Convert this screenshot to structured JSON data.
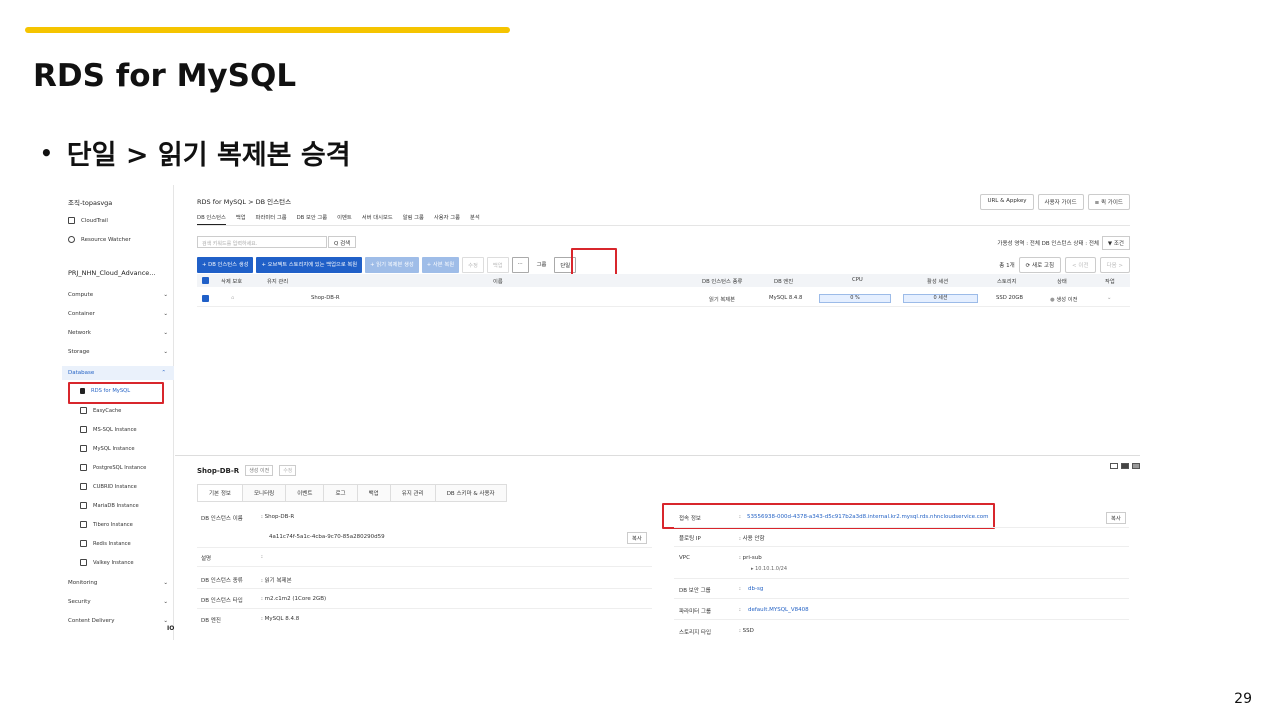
{
  "slide": {
    "title": "RDS for MySQL",
    "bullet": "단일 > 읽기 복제본 승격",
    "page_number": "29"
  },
  "sidebar": {
    "org": "조직-topasvga",
    "org_items": [
      {
        "label": "CloudTrail",
        "icon": "cloudtrail-icon"
      },
      {
        "label": "Resource Watcher",
        "icon": "gear-icon"
      }
    ],
    "project": "PRJ_NHN_Cloud_Advance...",
    "categories_top": [
      "Compute",
      "Container",
      "Network",
      "Storage"
    ],
    "active_category": "Database",
    "services": [
      "RDS for MySQL",
      "EasyCache",
      "MS-SQL Instance",
      "MySQL Instance",
      "PostgreSQL Instance",
      "CUBRID Instance",
      "MariaDB Instance",
      "Tibero Instance",
      "Redis Instance",
      "Valkey Instance"
    ],
    "selected_service": "RDS for MySQL",
    "categories_bottom": [
      "Monitoring",
      "Security",
      "Content Delivery"
    ],
    "footer_badge": "IO"
  },
  "console": {
    "breadcrumb": "RDS for MySQL  >  DB 인스턴스",
    "top_buttons": [
      "URL & Appkey",
      "사용자 가이드",
      "≡ 퀵 가이드"
    ],
    "tabs": [
      "DB 인스턴스",
      "백업",
      "파라미터 그룹",
      "DB 보안 그룹",
      "이벤트",
      "서버 대시보드",
      "알림 그룹",
      "사용자 그룹",
      "분석"
    ],
    "search_placeholder": "검색 키워드를 입력하세요.",
    "search_button": "Q 검색",
    "filter_text": "가용성 영역 : 전체   DB 인스턴스 상태 : 전체",
    "filter_button": "▼ 조건",
    "actions": {
      "create": "+ DB 인스턴스 생성",
      "restore": "+ 오브젝트 스토리지에 있는 백업으로 복원",
      "replica": "+ 읽기 복제본 생성",
      "copy": "+ 사본 복원",
      "modify": "수정",
      "backup": "백업",
      "more": "···",
      "group": "그룹",
      "single": "단일"
    },
    "count": "총 1개",
    "refresh": "새로 고침",
    "prev": "< 이전",
    "next": "다음 >",
    "table_headers": [
      "삭제 보호",
      "유지 관리",
      "이름",
      "DB 인스턴스 종류",
      "DB 엔진",
      "CPU",
      "활성 세션",
      "스토리지",
      "상태",
      "작업"
    ],
    "row": {
      "name": "Shop-DB-R",
      "type": "읽기 복제본",
      "engine": "MySQL 8.4.8",
      "cpu": "0 %",
      "cpu_fraction": 0.0,
      "sessions": "0 세션",
      "storage": "SSD 20GB",
      "status": "생성 이전"
    }
  },
  "detail": {
    "title": "Shop-DB-R",
    "badge_status": "생성 이전",
    "badge_edit": "수정",
    "tabs": [
      "기본 정보",
      "모니터링",
      "이벤트",
      "로그",
      "백업",
      "유지 관리",
      "DB 스키마 & 사용자"
    ],
    "left": [
      {
        "key": "DB 인스턴스 이름",
        "value": "Shop-DB-R"
      },
      {
        "key": "",
        "value": "4a11c74f-5a1c-4cba-9c70-85a280290d59"
      },
      {
        "key": "설명",
        "value": ""
      },
      {
        "key": "DB 인스턴스 종류",
        "value": "읽기 복제본"
      },
      {
        "key": "DB 인스턴스 타입",
        "value": "m2.c1m2 (1Core 2GB)"
      },
      {
        "key": "DB 엔진",
        "value": "MySQL 8.4.8"
      }
    ],
    "right": {
      "endpoint_label": "접속 정보",
      "endpoint": "53556938-000d-4378-a343-d5c917b2a3d8.internal.kr2.mysql.rds.nhncloudservice.com",
      "floating_ip_label": "플로팅 IP",
      "floating_ip": "사용 안함",
      "vpc_label": "VPC",
      "vpc": "pri-sub",
      "vpc_cidr": "10.10.1.0/24",
      "secgroup_label": "DB 보안 그룹",
      "secgroup": "db-sg",
      "param_label": "파라미터 그룹",
      "param": "default.MYSQL_V8408",
      "storage_label": "스토리지 타입",
      "storage": "SSD"
    },
    "copy_label": "복사"
  },
  "colors": {
    "accent_yellow": "#f5c400",
    "highlight_red": "#d8262c",
    "primary_blue": "#2060c8"
  }
}
